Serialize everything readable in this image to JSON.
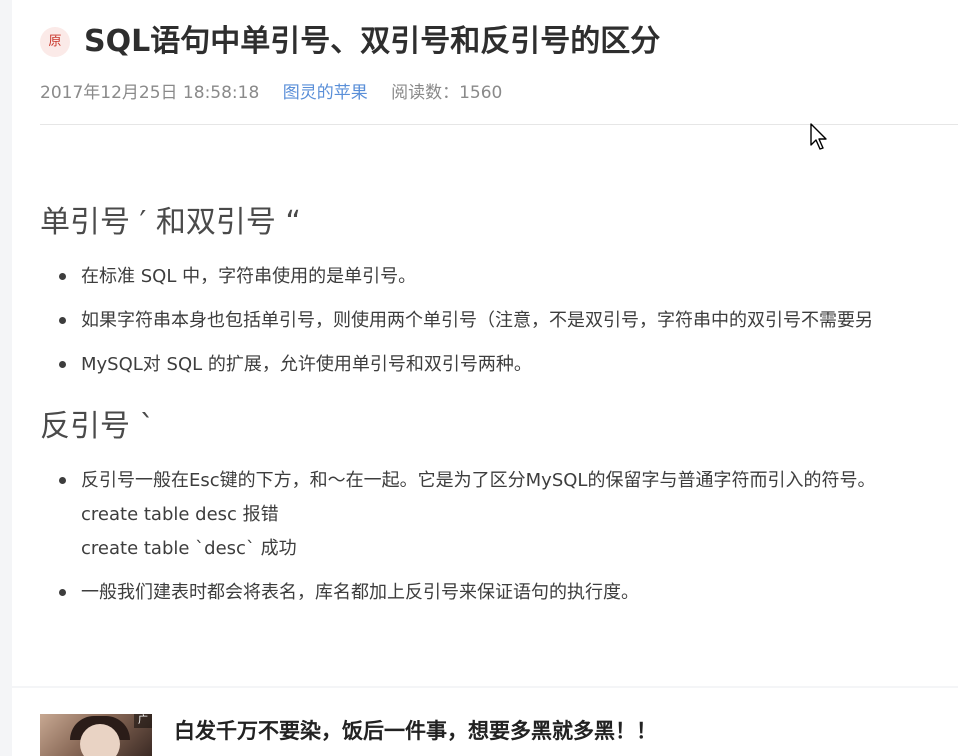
{
  "article": {
    "badge": "原",
    "title": "SQL语句中单引号、双引号和反引号的区分",
    "date": "2017年12月25日 18:58:18",
    "author": "图灵的苹果",
    "read_count": "阅读数：1560"
  },
  "sections": [
    {
      "heading": "单引号 ′ 和双引号 “",
      "items": [
        {
          "text": "在标准 SQL 中，字符串使用的是单引号。"
        },
        {
          "text": "如果字符串本身也包括单引号，则使用两个单引号（注意，不是双引号，字符串中的双引号不需要另"
        },
        {
          "text": "MySQL对 SQL 的扩展，允许使用单引号和双引号两种。"
        }
      ]
    },
    {
      "heading": "反引号 `",
      "items": [
        {
          "text": "反引号一般在Esc键的下方，和～在一起。它是为了区分MySQL的保留字与普通字符而引入的符号。",
          "lines": [
            "create table desc 报错",
            "create table `desc` 成功"
          ]
        },
        {
          "text": "一般我们建表时都会将表名，库名都加上反引号来保证语句的执行度。"
        }
      ]
    }
  ],
  "ad": {
    "tag": "广告",
    "title": "白发千万不要染，饭后一件事，想要多黑就多黑！！"
  },
  "colors": {
    "author_link": "#5a8fd8",
    "badge_text": "#c9362b",
    "badge_bg": "#fbeae8"
  }
}
